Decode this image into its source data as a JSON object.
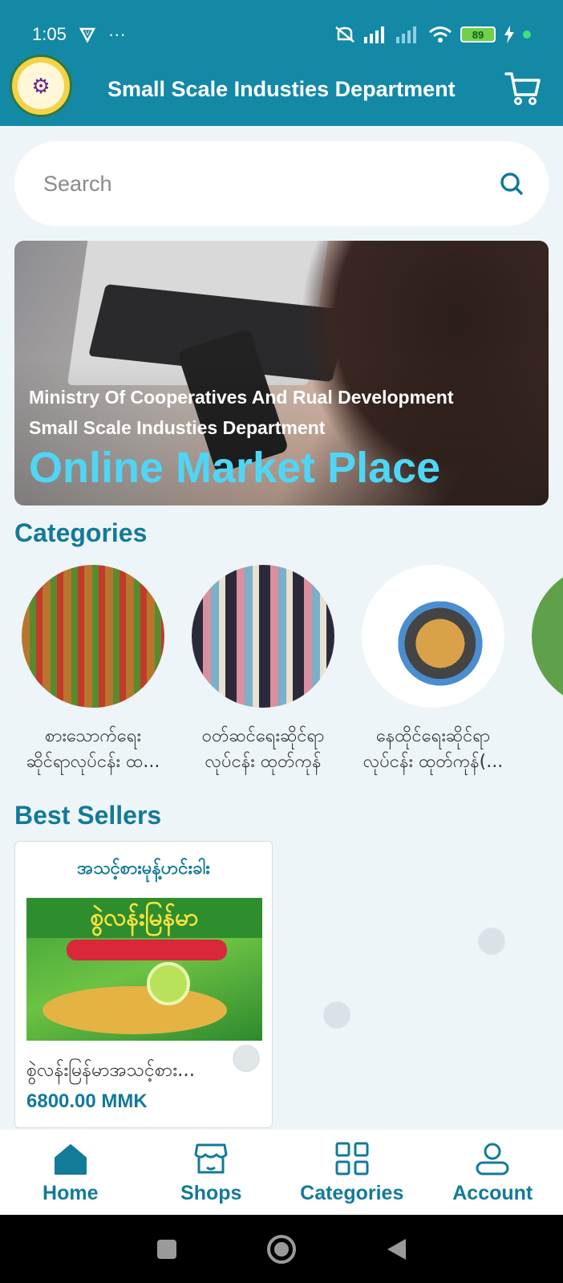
{
  "status_bar": {
    "time": "1:05",
    "more": "···",
    "battery": "89"
  },
  "header": {
    "title": "Small Scale Industies Department",
    "cart_icon": "cart-icon",
    "color": "#1389a6"
  },
  "search": {
    "placeholder": "Search",
    "icon": "search-icon"
  },
  "banner": {
    "line1": "Ministry Of  Cooperatives And Rual Development",
    "line2": "Small Scale Industies Department",
    "line3": "Online Market Place"
  },
  "categories": {
    "title": "Categories",
    "items": [
      {
        "label_line1": "စားသောက်ရေး",
        "label_line2": "ဆိုင်ရာလုပ်ငန်း ထ..."
      },
      {
        "label_line1": "ဝတ်ဆင်ရေးဆိုင်ရာ",
        "label_line2": "လုပ်ငန်း ထုတ်ကုန်"
      },
      {
        "label_line1": "နေထိုင်ရေးဆိုင်ရာ",
        "label_line2": "လုပ်ငန်း ထုတ်ကုန်(..."
      }
    ]
  },
  "best_sellers": {
    "title": "Best Sellers",
    "items": [
      {
        "shop": "အသင့်စားမုန့်ဟင်းခါး",
        "name": "စွဲလန်းမြန်မာအသင့်စား...",
        "price": "6800.00 MMK",
        "package_text": "စွဲလန်းမြန်မာ"
      }
    ]
  },
  "bottom_nav": {
    "items": [
      {
        "label": "Home",
        "icon": "home-icon"
      },
      {
        "label": "Shops",
        "icon": "shop-icon"
      },
      {
        "label": "Categories",
        "icon": "grid-icon"
      },
      {
        "label": "Account",
        "icon": "person-icon"
      }
    ]
  },
  "colors": {
    "accent": "#1389a6",
    "text_accent": "#137a98",
    "banner_highlight": "#4fd6f5"
  }
}
